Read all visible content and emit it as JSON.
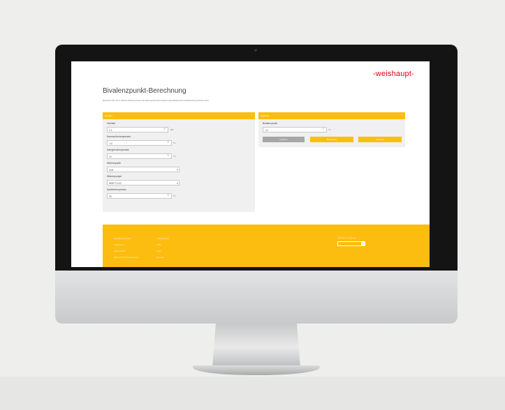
{
  "app": {
    "brand": "-weishaupt-",
    "title": "Bivalenzpunkt-Berechnung",
    "intro": "Berechnen Sie, bis zu welcher Außentemperatur die Wärmepumpe das Gebäude eigenständig (ohne Zusatzheizung) beheizen kann."
  },
  "input_panel": {
    "title": "Eingabe",
    "collapse_icon": "chevron-up-icon",
    "fields": [
      {
        "label": "Heizlast",
        "value": "1,2",
        "unit": "kW",
        "kind": "stepper"
      },
      {
        "label": "Normaußentemperatur",
        "value": "-10",
        "unit": "°C",
        "kind": "stepper"
      },
      {
        "label": "Heizgrenztemperatur",
        "value": "15",
        "unit": "°C",
        "kind": "stepper"
      },
      {
        "label": "Wärmequelle",
        "value": "Sole",
        "unit": "",
        "kind": "select"
      },
      {
        "label": "Wärmepumpe",
        "value": "WWP S 6 ID",
        "unit": "",
        "kind": "select"
      },
      {
        "label": "Systemtemperatur",
        "value": "35",
        "unit": "°C",
        "kind": "stepper"
      }
    ]
  },
  "output_panel": {
    "title": "Ergebnis",
    "collapse_icon": "chevron-up-icon",
    "result_label": "Bivalenzpunkt",
    "result_value": "-10",
    "result_unit": "°C",
    "buttons": [
      "Löschen",
      "Berechnen",
      "Drucken"
    ]
  },
  "footer": {
    "rows": [
      {
        "label": "Weishaupt Gruppe",
        "value": "Unternehmen"
      },
      {
        "label": "Impressum",
        "value": "AGB"
      },
      {
        "label": "Datenschutz",
        "value": "AGB"
      },
      {
        "label": "Datenschutzeinstellungen",
        "value": "Kontakt"
      }
    ],
    "language_label": "Sprache / Language",
    "colors": {
      "accent": "#fdbd10",
      "brand": "#e3000f"
    }
  }
}
